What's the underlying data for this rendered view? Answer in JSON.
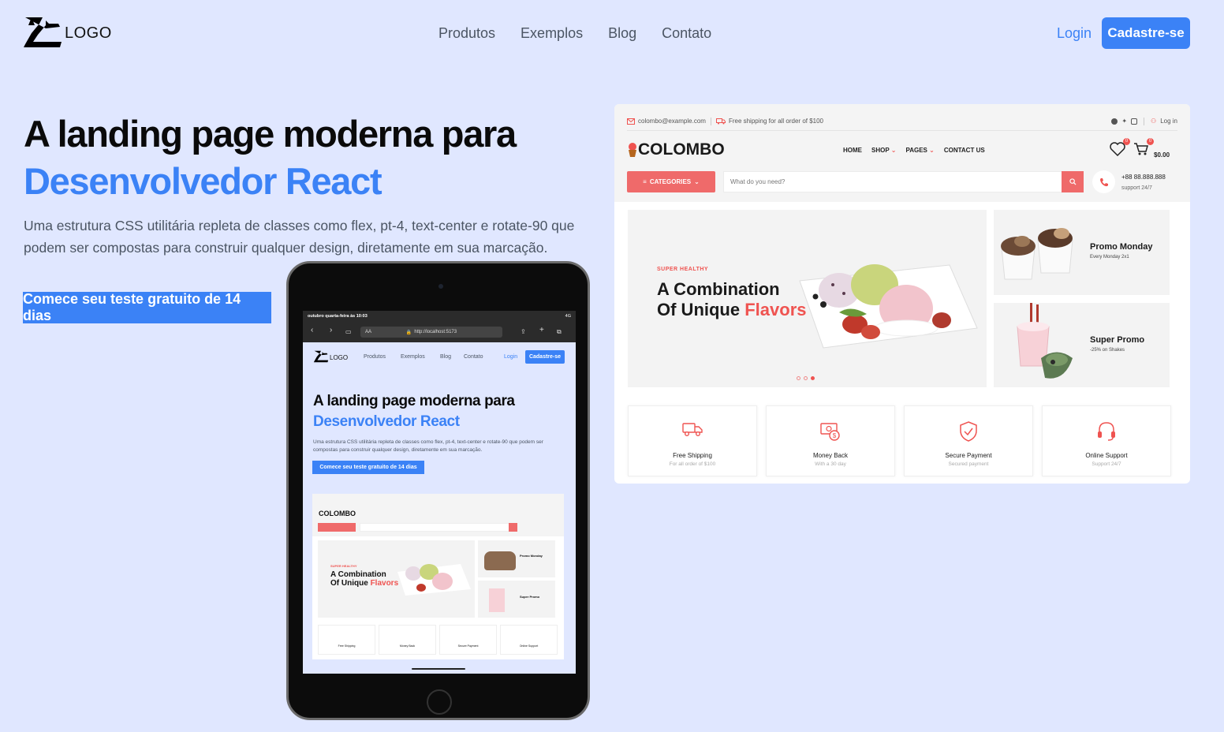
{
  "nav": {
    "logo_text": "LOGO",
    "links": [
      "Produtos",
      "Exemplos",
      "Blog",
      "Contato"
    ],
    "login": "Login",
    "signup": "Cadastre-se"
  },
  "hero": {
    "title_line1": "A landing page moderna para",
    "title_line2": "Desenvolvedor React",
    "description": "Uma estrutura CSS utilitária repleta de classes como flex, pt-4, text-center e rotate-90 que podem ser compostas para construir qualquer design, diretamente em sua marcação.",
    "cta": "Comece seu teste gratuito de 14 dias"
  },
  "colors": {
    "accent": "#3b82f6",
    "background": "#e0e7ff",
    "shop_accent": "#ef5350"
  },
  "shop_preview": {
    "email": "colombo@example.com",
    "shipping_notice": "Free shipping for all order of $100",
    "login": "Log in",
    "brand": "COLOMBO",
    "menu": [
      "HOME",
      "SHOP",
      "PAGES",
      "CONTACT US"
    ],
    "cart_total": "$0.00",
    "categories": "CATEGORIES",
    "search_placeholder": "What do you need?",
    "phone": "+88 88.888.888",
    "phone_sub": "support 24/7",
    "banner": {
      "eyebrow": "SUPER HEALTHY",
      "headline_line1": "A Combination",
      "headline_line2": "Of Unique",
      "headline_highlight": "Flavors"
    },
    "promos": [
      {
        "title": "Promo Monday",
        "subtitle": "Every Monday 2x1"
      },
      {
        "title": "Super Promo",
        "subtitle": "-25% on Shakes"
      }
    ],
    "features": [
      {
        "title": "Free Shipping",
        "subtitle": "For all order of $100",
        "icon": "truck-icon"
      },
      {
        "title": "Money Back",
        "subtitle": "With a 30 day",
        "icon": "money-icon"
      },
      {
        "title": "Secure Payment",
        "subtitle": "Secured payment",
        "icon": "shield-icon"
      },
      {
        "title": "Online Support",
        "subtitle": "Support 24/7",
        "icon": "headset-icon"
      }
    ]
  },
  "tablet": {
    "status_time": "outubro quarta-feira às 10:03",
    "status_right": "4G",
    "url": "http://localhost:5173",
    "url_prefix": "AA"
  }
}
